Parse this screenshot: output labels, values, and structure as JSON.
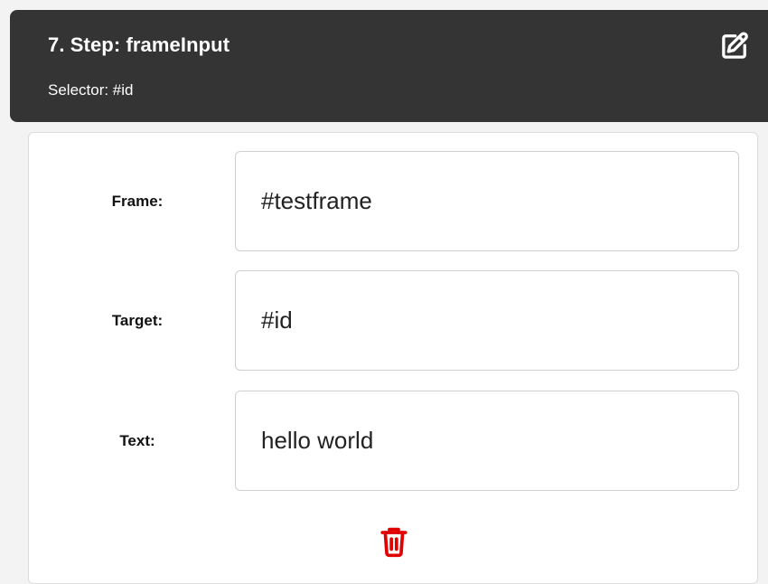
{
  "step": {
    "title": "7. Step: frameInput",
    "selector_text": "Selector: #id",
    "edit_icon": "edit-pencil-icon"
  },
  "fields": [
    {
      "label": "Frame:",
      "value": "#testframe"
    },
    {
      "label": "Target:",
      "value": "#id"
    },
    {
      "label": "Text:",
      "value": "hello world"
    }
  ],
  "actions": {
    "delete_icon": "trash-icon",
    "delete_color": "#e00000"
  },
  "colors": {
    "header_bg": "#343434",
    "header_text": "#ffffff",
    "body_bg": "#ffffff"
  }
}
